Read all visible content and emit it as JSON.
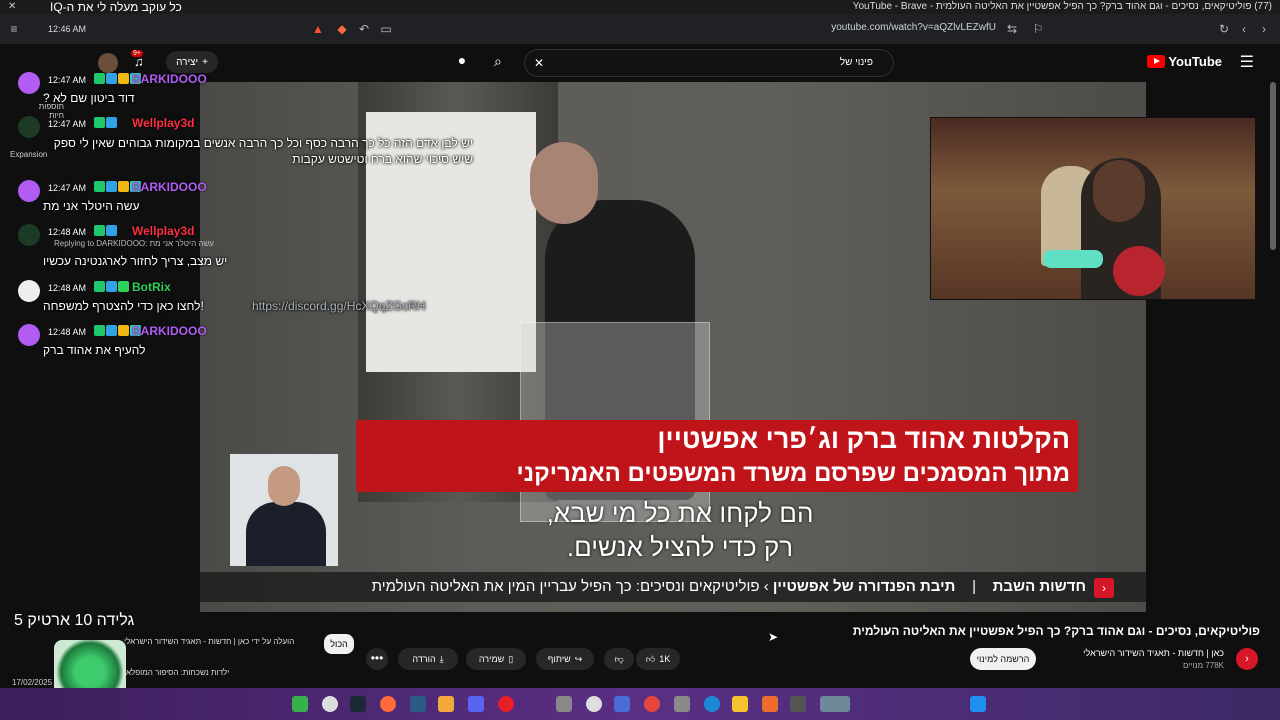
{
  "window": {
    "title": "(77) פוליטיקאים, נסיכים - וגם אהוד ברק? כך הפיל אפשטיין את האליטה העולמית - YouTube - Brave",
    "banner_text": "כל עוקב מעלה לי את ה-IQ",
    "clock": "12:46 AM"
  },
  "browser": {
    "url": "youtube.com/watch?v=aQZlvLEZwfU"
  },
  "youtube": {
    "logo_text": "YouTube",
    "search_query": "פינוי של",
    "create_label": "יצירה",
    "notification_count": "9+"
  },
  "video": {
    "headline_line1": "הקלטות אהוד ברק וג׳פרי אפשטיין",
    "headline_line2": "מתוך המסמכים שפרסם משרד המשפטים האמריקני",
    "subtitle_line1": "הם לקחו את כל מי שבא,",
    "subtitle_line2": "רק כדי להציל אנשים.",
    "news_show": "חדשות השבת",
    "news_separator": "|",
    "news_series": "תיבת הפנדורה של אפשטיין",
    "news_chevron": "›",
    "news_episode": "פוליטיקאים ונסיכים: כך הפיל עבריין המין את האליטה העולמית"
  },
  "chat": {
    "messages": [
      {
        "time": "12:47 AM",
        "user": "DARKIDOOO",
        "color": "#b35cf2",
        "text": "דוד ביטון שם לא ?"
      },
      {
        "time": "12:47 AM",
        "user": "Wellplay3d",
        "color": "#ff2e40",
        "text": "יש לבן אדם הזה כל כך הרבה כסף וכל כך הרבה אנשים במקומות גבוהים שאין לי ספק שיש סיכוי שהוא ברח וטישטש עקבות"
      },
      {
        "time": "12:47 AM",
        "user": "DARKIDOOO",
        "color": "#b35cf2",
        "text": "עשה היטלר אני מת"
      },
      {
        "time": "12:48 AM",
        "user": "Wellplay3d",
        "color": "#ff2e40",
        "reply": "Replying to DARKIDOOO: עשה היטלר אני מת",
        "text": "יש מצב, צריך לחזור לארגנטינה עכשיו"
      },
      {
        "time": "12:48 AM",
        "user": "BotRix",
        "color": "#2ed15a",
        "text": "!לחצו כאן כדי להצטרף למשפחה",
        "link": "https://discord.gg/HcXQqZGcRH"
      },
      {
        "time": "12:48 AM",
        "user": "DARKIDOOO",
        "color": "#b35cf2",
        "text": "להעיף את אהוד ברק"
      }
    ],
    "side_label_1": "תוספות חיות",
    "side_label_2": "Expansion"
  },
  "below": {
    "video_title": "פוליטיקאים, נסיכים - וגם אהוד ברק? כך הפיל אפשטיין את האליטה העולמית",
    "channel_name": "כאן | חדשות - תאגיד השידור הישראלי",
    "channel_subs": "778K מנויים",
    "subscribe_label": "הרשמה למינוי",
    "like_count": "1K",
    "share_label": "שיתוף",
    "save_label": "שמירה",
    "download_label": "הורדה",
    "more_label": "•••",
    "chip_all": "הכול",
    "chip_uploaded": "הועלה על ידי כאן | חדשות - תאגיד השידור הישראלי",
    "gift_text": "גלידה 10 ארטיק 5",
    "rec_text": "ילדות נשכחות: הסיפור המופלא",
    "date": "17/02/2025"
  }
}
